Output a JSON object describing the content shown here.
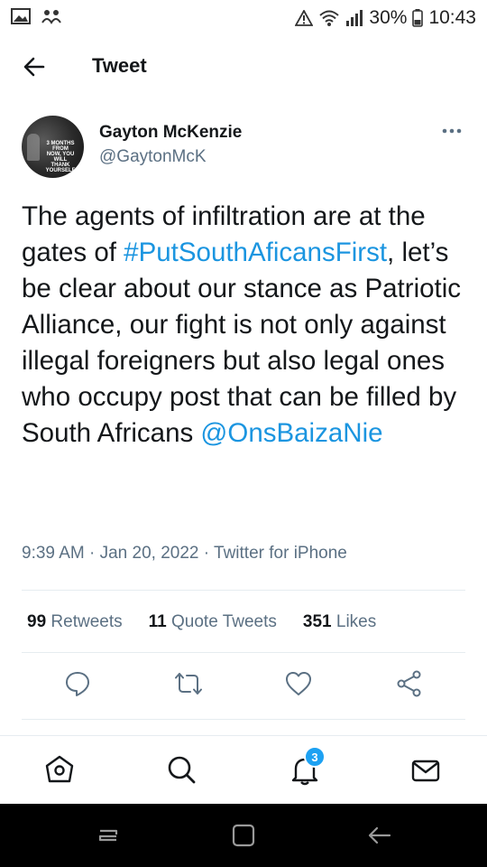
{
  "status_bar": {
    "battery": "30%",
    "time": "10:43",
    "icons": [
      "gallery-icon",
      "people-icon",
      "alert-icon",
      "wifi-icon",
      "signal-icon",
      "battery-icon"
    ]
  },
  "header": {
    "title": "Tweet",
    "back_icon": "arrow-left-icon"
  },
  "tweet": {
    "author": {
      "name": "Gayton McKenzie",
      "handle": "@GaytonMcK",
      "avatar_text": "3 MONTHS FROM NOW, YOU WILL THANK YOURSELF"
    },
    "text_parts": {
      "p1": "The agents of infiltration are at the gates of ",
      "hashtag": "#PutSouthAficansFirst",
      "p2": ", let’s be clear about our stance as Patriotic Alliance, our fight is not only against illegal foreigners but also legal ones who occupy post that can be filled by South Africans ",
      "mention": "@OnsBaizaNie"
    },
    "meta": {
      "time": "9:39 AM",
      "date": "Jan 20, 2022",
      "source": "Twitter for iPhone",
      "sep": " · "
    },
    "stats": {
      "retweets_count": "99",
      "retweets_label": "Retweets",
      "quotes_count": "11",
      "quotes_label": "Quote Tweets",
      "likes_count": "351",
      "likes_label": "Likes"
    }
  },
  "actions": [
    "reply-icon",
    "retweet-icon",
    "like-icon",
    "share-icon"
  ],
  "bottom_nav": {
    "items": [
      "home-icon",
      "search-icon",
      "notifications-icon",
      "messages-icon"
    ],
    "notifications_badge": "3"
  },
  "system_nav": [
    "recents-icon",
    "home-square-icon",
    "back-icon"
  ],
  "colors": {
    "link": "#1b95e0",
    "secondary_text": "#5b7083",
    "accent": "#1da1f2"
  }
}
